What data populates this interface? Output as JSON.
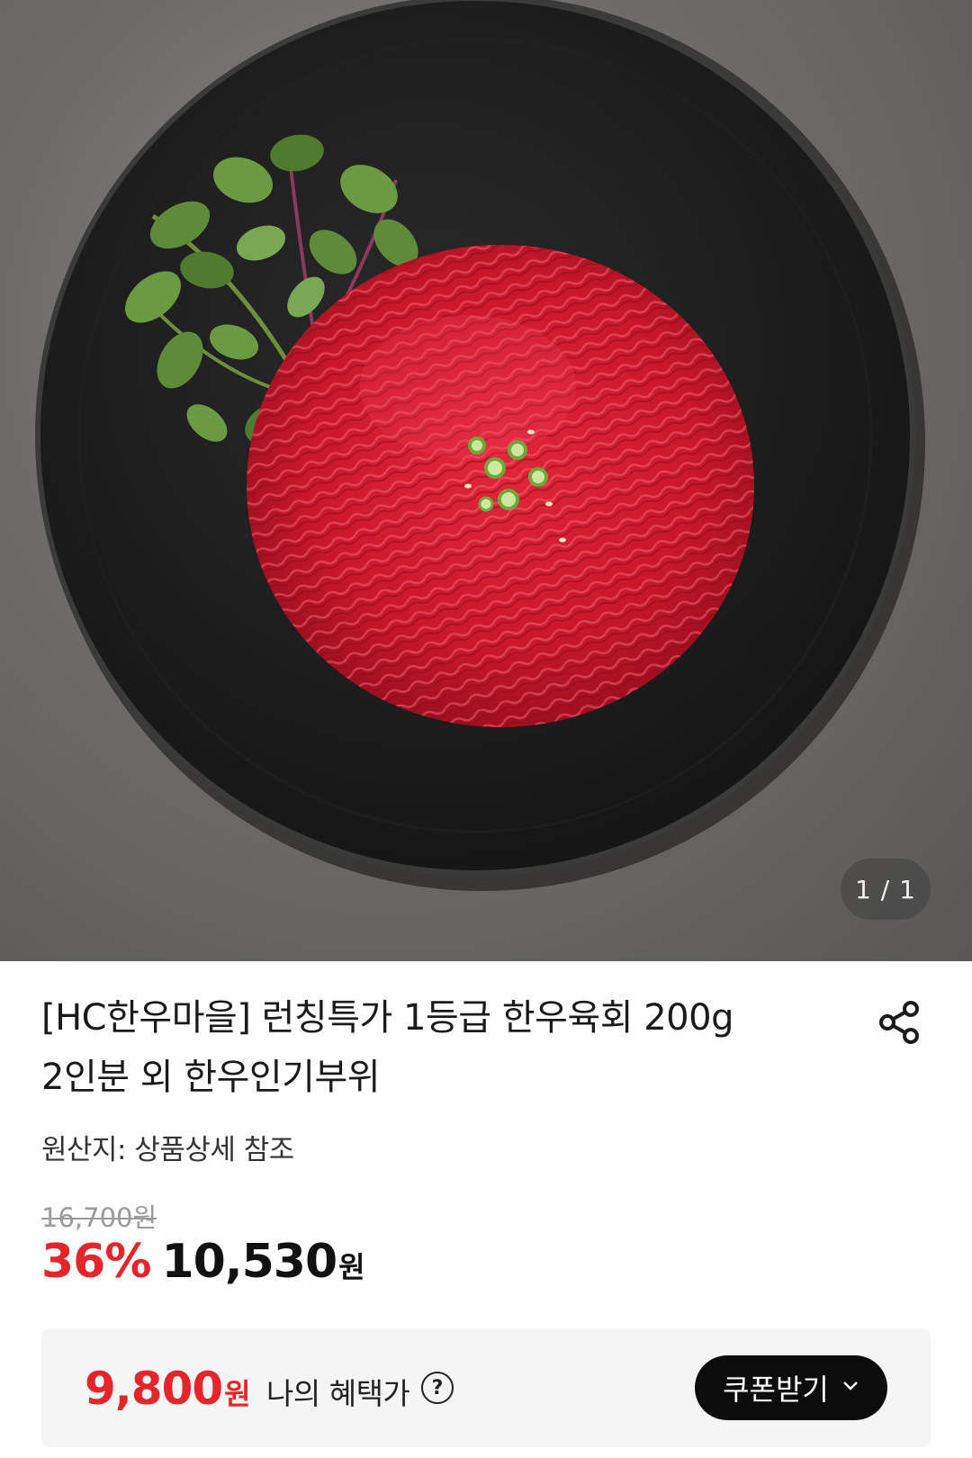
{
  "gallery": {
    "counter": "1 / 1"
  },
  "product": {
    "title_line1": "[HC한우마을] 런칭특가 1등급 한우육회 200g",
    "title_line2": "2인분 외 한우인기부위",
    "origin": "원산지: 상품상세 참조"
  },
  "pricing": {
    "original_price": "16,700원",
    "discount": "36%",
    "price": "10,530",
    "currency": "원"
  },
  "benefit": {
    "price": "9,800",
    "currency": "원",
    "label": "나의 혜택가",
    "help_symbol": "?",
    "coupon_button": "쿠폰받기"
  },
  "colors": {
    "accent_red": "#e5252a",
    "button_black": "#0c0c0c",
    "benefit_bg": "#f5f5f5"
  },
  "icons": {
    "share": "share-icon",
    "help": "question-circle-icon",
    "chevron": "chevron-down-icon"
  }
}
